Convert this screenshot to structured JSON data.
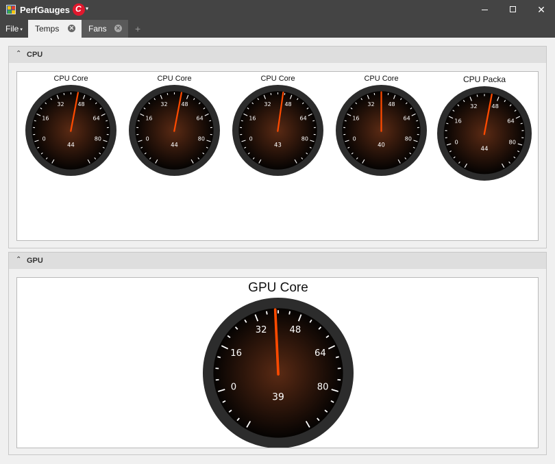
{
  "window": {
    "title": "PerfGauges",
    "brand_letter": "C",
    "caret": "▾",
    "minimize_label": "",
    "maximize_label": "",
    "close_label": "✕"
  },
  "menu": {
    "file_label": "File",
    "file_caret": "▾"
  },
  "tabs": [
    {
      "label": "Temps",
      "close": "✕"
    },
    {
      "label": "Fans",
      "close": "✕"
    }
  ],
  "add_tab_label": "+",
  "groups": {
    "cpu": {
      "title": "CPU",
      "collapse": "⌃"
    },
    "gpu": {
      "title": "GPU",
      "collapse": "⌃"
    }
  },
  "colors": {
    "bezel": "#2c2c2c",
    "face_center": "#5a2a14",
    "face_edge": "#050302",
    "needle": "#ff4a00",
    "tick": "#ffffff",
    "titlebar": "#444444"
  },
  "gauge_scale": {
    "min": -16,
    "max": 96,
    "labels": [
      0,
      16,
      32,
      48,
      64,
      80
    ]
  },
  "gauges": [
    {
      "title": "CPU Core",
      "value": 44,
      "value_label": "44"
    },
    {
      "title": "CPU Core",
      "value": 44,
      "value_label": "44"
    },
    {
      "title": "CPU Core",
      "value": 43,
      "value_label": "43"
    },
    {
      "title": "CPU Core",
      "value": 40,
      "value_label": "40"
    },
    {
      "title": "CPU Packa",
      "value": 44,
      "value_label": "44"
    },
    {
      "title": "GPU Core",
      "value": 39,
      "value_label": "39"
    }
  ]
}
